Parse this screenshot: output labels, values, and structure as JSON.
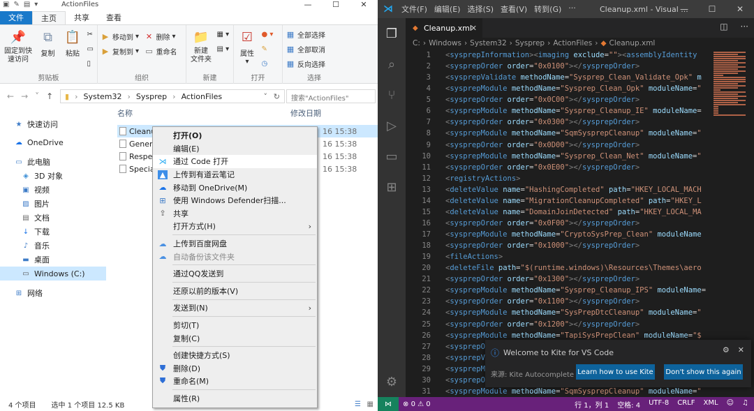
{
  "explorer": {
    "window_title": "ActionFiles",
    "tabs": [
      "文件",
      "主页",
      "共享",
      "查看"
    ],
    "ribbon": {
      "clipboard": {
        "pin": "固定到快\n速访问",
        "copy": "复制",
        "paste": "粘贴",
        "label": "剪贴板"
      },
      "organize": {
        "move_to": "移动到",
        "copy_to": "复制到",
        "delete": "删除",
        "rename": "重命名",
        "label": "组织"
      },
      "new": {
        "new_folder": "新建\n文件夹",
        "label": "新建"
      },
      "open": {
        "properties": "属性",
        "label": "打开"
      },
      "select": {
        "select_all": "全部选择",
        "select_none": "全部取消",
        "invert": "反向选择",
        "label": "选择"
      }
    },
    "address": {
      "crumbs": [
        "System32",
        "Sysprep",
        "ActionFiles"
      ],
      "search_placeholder": "搜索\"ActionFiles\""
    },
    "nav": [
      {
        "label": "快速访问",
        "icon": "star-icon",
        "level": 0
      },
      {
        "label": "OneDrive",
        "icon": "cloud-icon",
        "level": 0
      },
      {
        "label": "此电脑",
        "icon": "computer-icon",
        "level": 0
      },
      {
        "label": "3D 对象",
        "icon": "cube-icon",
        "level": 1
      },
      {
        "label": "视频",
        "icon": "video-icon",
        "level": 1
      },
      {
        "label": "图片",
        "icon": "picture-icon",
        "level": 1
      },
      {
        "label": "文档",
        "icon": "document-icon",
        "level": 1
      },
      {
        "label": "下载",
        "icon": "download-icon",
        "level": 1
      },
      {
        "label": "音乐",
        "icon": "music-icon",
        "level": 1
      },
      {
        "label": "桌面",
        "icon": "desktop-icon",
        "level": 1
      },
      {
        "label": "Windows (C:)",
        "icon": "drive-icon",
        "level": 1,
        "selected": true
      },
      {
        "label": "网络",
        "icon": "network-icon",
        "level": 0
      }
    ],
    "columns": {
      "name": "名称",
      "date": "修改日期"
    },
    "files": [
      {
        "name": "Cleanu",
        "date": "16 15:38",
        "selected": true
      },
      {
        "name": "Genera",
        "date": "16 15:38"
      },
      {
        "name": "Respec",
        "date": "16 15:38"
      },
      {
        "name": "Specia",
        "date": "16 15:38"
      }
    ],
    "status": {
      "count": "4 个项目",
      "selected": "选中 1 个项目  12.5 KB"
    }
  },
  "context_menu": [
    {
      "label": "打开(O)",
      "bold": true
    },
    {
      "label": "编辑(E)"
    },
    {
      "label": "通过 Code 打开",
      "icon": "vscode-icon",
      "highlight": true
    },
    {
      "label": "上传到有道云笔记",
      "icon": "youdao-icon"
    },
    {
      "label": "移动到 OneDrive(M)",
      "icon": "cloud-icon"
    },
    {
      "label": "使用 Windows Defender扫描...",
      "icon": "defender-icon"
    },
    {
      "label": "共享",
      "icon": "share-icon"
    },
    {
      "label": "打开方式(H)",
      "submenu": true
    },
    {
      "sep": true
    },
    {
      "label": "上传到百度网盘",
      "icon": "baidu-icon"
    },
    {
      "label": "自动备份该文件夹",
      "icon": "baidu-icon",
      "disabled": true
    },
    {
      "sep": true
    },
    {
      "label": "通过QQ发送到"
    },
    {
      "sep": true
    },
    {
      "label": "还原以前的版本(V)"
    },
    {
      "sep": true
    },
    {
      "label": "发送到(N)",
      "submenu": true
    },
    {
      "sep": true
    },
    {
      "label": "剪切(T)"
    },
    {
      "label": "复制(C)"
    },
    {
      "sep": true
    },
    {
      "label": "创建快捷方式(S)"
    },
    {
      "label": "删除(D)",
      "icon": "shield-icon"
    },
    {
      "label": "重命名(M)",
      "icon": "shield-icon"
    },
    {
      "sep": true
    },
    {
      "label": "属性(R)"
    }
  ],
  "vscode": {
    "menus": [
      "文件(F)",
      "编辑(E)",
      "选择(S)",
      "查看(V)",
      "转到(G)",
      "···"
    ],
    "window_title": "Cleanup.xml - Visual ...",
    "tab_name": "Cleanup.xml",
    "breadcrumbs": [
      "C:",
      "Windows",
      "System32",
      "Sysprep",
      "ActionFiles",
      "Cleanup.xml"
    ],
    "code_lines": [
      "<sysprepInformation><imaging exclude=\"\"><assemblyIdentity",
      "<sysprepOrder order=\"0x0100\"></sysprepOrder>",
      "<sysprepValidate methodName=\"Sysprep_Clean_Validate_Opk\" m",
      "<sysprepModule methodName=\"Sysprep_Clean_Opk\" moduleName=\"",
      "<sysprepOrder order=\"0x0C00\"></sysprepOrder>",
      "<sysprepModule methodName=\"Sysprep_Cleanup_IE\" moduleName=",
      "<sysprepOrder order=\"0x0300\"></sysprepOrder>",
      "<sysprepModule methodName=\"SqmSysprepCleanup\" moduleName=\"",
      "<sysprepOrder order=\"0x0D00\"></sysprepOrder>",
      "<sysprepModule methodName=\"Sysprep_Clean_Net\" moduleName=\"",
      "<sysprepOrder order=\"0x0E00\"></sysprepOrder>",
      "<registryActions>",
      "<deleteValue name=\"HashingCompleted\" path=\"HKEY_LOCAL_MACH",
      "<deleteValue name=\"MigrationCleanupCompleted\" path=\"HKEY_L",
      "<deleteValue name=\"DomainJoinDetected\" path=\"HKEY_LOCAL_MA",
      "<sysprepOrder order=\"0x0F00\"></sysprepOrder>",
      "<sysprepModule methodName=\"CryptoSysPrep_Clean\" moduleName",
      "<sysprepOrder order=\"0x1000\"></sysprepOrder>",
      "<fileActions>",
      "<deleteFile path=\"$(runtime.windows)\\Resources\\Themes\\aero",
      "<sysprepOrder order=\"0x1300\"></sysprepOrder>",
      "<sysprepModule methodName=\"Sysprep_Cleanup_IPS\" moduleName=",
      "<sysprepOrder order=\"0x1100\"></sysprepOrder>",
      "<sysprepModule methodName=\"SysPrepDtcCleanup\" moduleName=\"",
      "<sysprepOrder order=\"0x1200\"></sysprepOrder>",
      "<sysprepModule methodName=\"TapiSysPrepClean\" moduleName=\"$",
      "<sysprepO",
      "<sysprepV",
      "<sysprepM",
      "<sysprepO",
      "<sysprepModule methodName=\"SqmSysprepCleanup\" moduleName=\""
    ],
    "notification": {
      "title": "Welcome to Kite for VS Code",
      "source": "来源: Kite Autocomplete f...",
      "button1": "Learn how to use Kite",
      "button2": "Don't show this again"
    },
    "status": {
      "errors": "0",
      "warnings": "0",
      "position": "行 1，列 1",
      "spaces": "空格: 4",
      "encoding": "UTF-8",
      "eol": "CRLF",
      "language": "XML"
    },
    "colors": {
      "status_bar": "#68217a",
      "remote": "#16825d",
      "tag": "#569cd6",
      "attr": "#9cdcfe",
      "string": "#ce9178"
    }
  }
}
